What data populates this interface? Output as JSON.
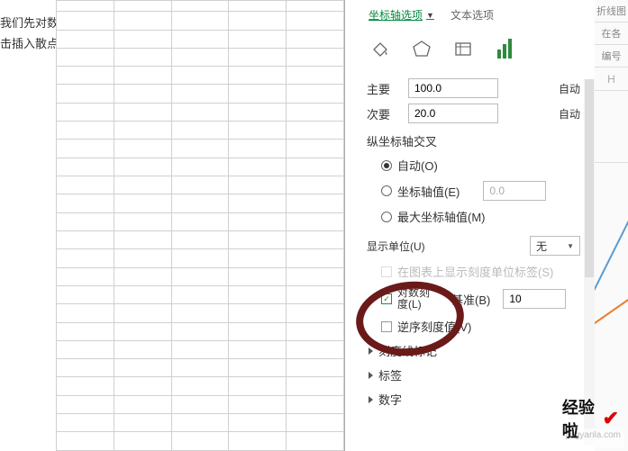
{
  "left_partial": {
    "line1": "我们先对数",
    "line2": "击插入散点"
  },
  "panel": {
    "axis_options": "坐标轴选项",
    "text_options": "文本选项",
    "units": {
      "major_label": "主要",
      "major_value": "100.0",
      "major_auto": "自动",
      "minor_label": "次要",
      "minor_value": "20.0",
      "minor_auto": "自动"
    },
    "cross_title": "纵坐标轴交叉",
    "cross": {
      "auto": "自动(O)",
      "value_label": "坐标轴值(E)",
      "value_input": "0.0",
      "max_label": "最大坐标轴值(M)"
    },
    "display_unit_label": "显示单位(U)",
    "display_unit_value": "无",
    "show_unit_label_on_chart": "在图表上显示刻度单位标签(S)",
    "log_scale_label_l1": "对数刻",
    "log_scale_label_l2": "度(L)",
    "log_base_label": "基准(B)",
    "log_base_value": "10",
    "reverse_label": "逆序刻度值(V)",
    "expanders": {
      "ticks": "刻度线标记",
      "labels": "标签",
      "numbers": "数字"
    }
  },
  "right_tabs": [
    "折线图",
    "在各",
    "编号"
  ],
  "right_letter": "H",
  "watermark": {
    "text": "经验啦",
    "url": "jingyanla.com"
  },
  "icons": {
    "fill": "fill-bucket-icon",
    "effects": "pentagon-effects-icon",
    "size": "size-properties-icon",
    "bars": "bar-chart-icon"
  }
}
